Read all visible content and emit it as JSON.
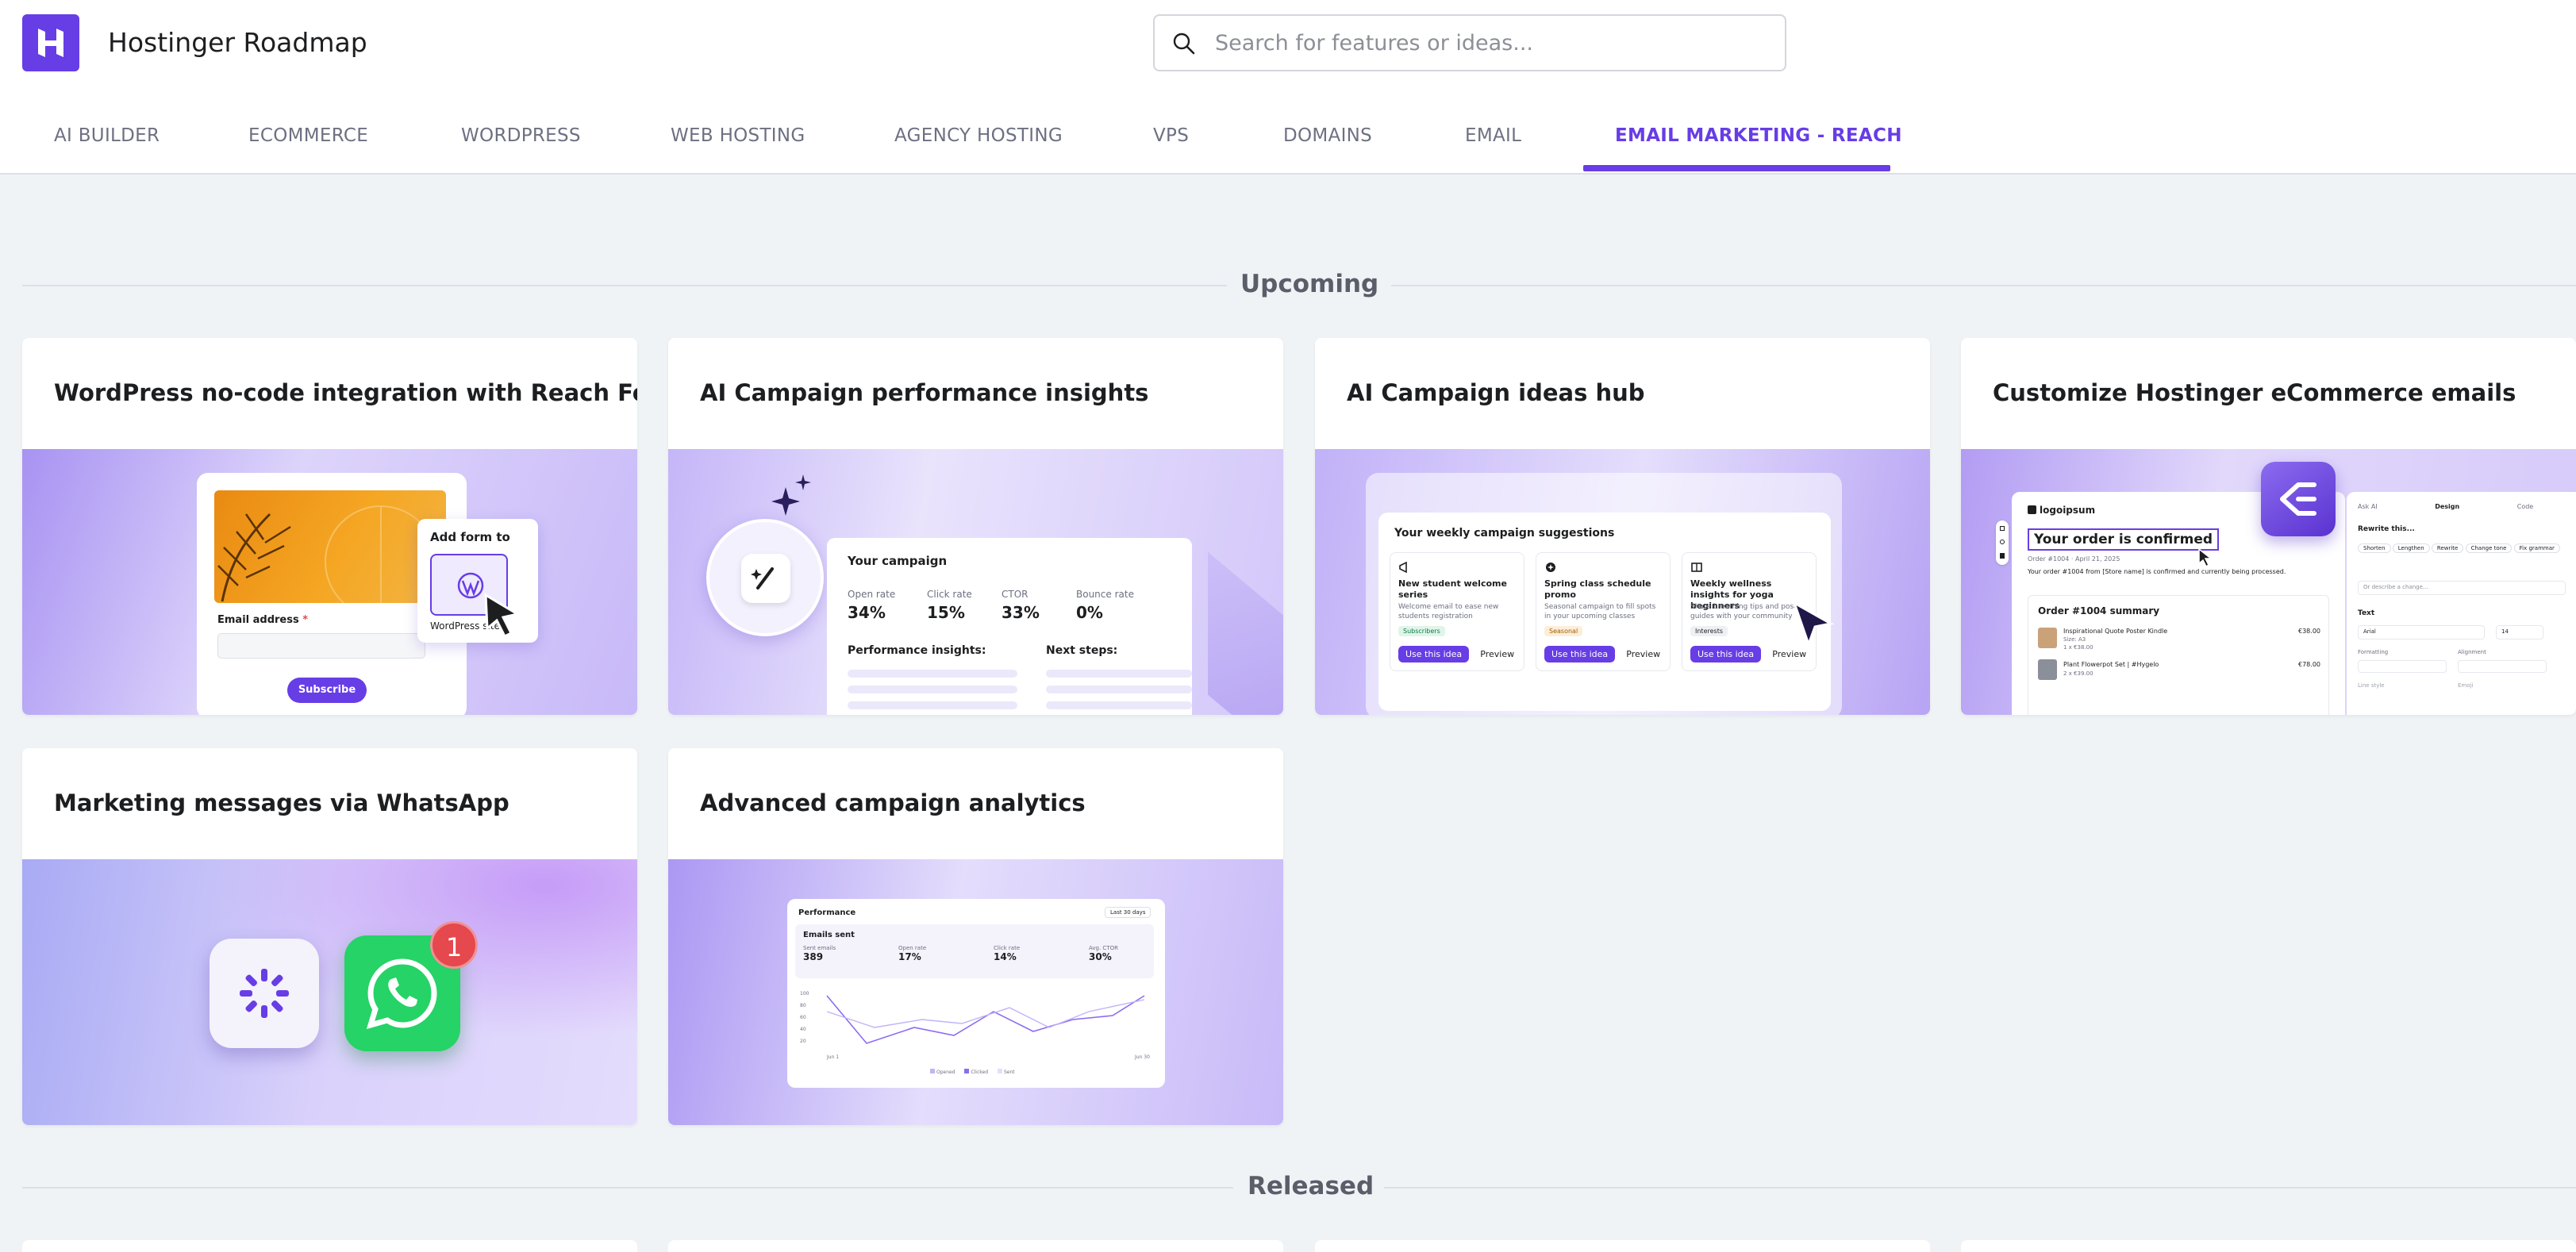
{
  "app": {
    "title": "Hostinger Roadmap",
    "logo_icon": "hostinger-logo-icon",
    "accent": "#673de6"
  },
  "search": {
    "placeholder": "Search for features or ideas...",
    "value": "",
    "icon": "search-icon"
  },
  "tabs": [
    {
      "label": "AI BUILDER",
      "active": false
    },
    {
      "label": "ECOMMERCE",
      "active": false
    },
    {
      "label": "WORDPRESS",
      "active": false
    },
    {
      "label": "WEB HOSTING",
      "active": false
    },
    {
      "label": "AGENCY HOSTING",
      "active": false
    },
    {
      "label": "VPS",
      "active": false
    },
    {
      "label": "DOMAINS",
      "active": false
    },
    {
      "label": "EMAIL",
      "active": false
    },
    {
      "label": "EMAIL MARKETING - REACH",
      "active": true
    }
  ],
  "sections": {
    "upcoming": "Upcoming",
    "released": "Released"
  },
  "cards": [
    {
      "title": "WordPress no-code integration with Reach Forms",
      "image": {
        "add_form_label": "Add form to",
        "wp_label": "WordPress site",
        "email_label": "Email address",
        "required_mark": "*",
        "subscribe": "Subscribe"
      }
    },
    {
      "title": "AI Campaign performance insights",
      "image": {
        "heading": "Your campaign",
        "stats": [
          {
            "label": "Open rate",
            "value": "34%"
          },
          {
            "label": "Click rate",
            "value": "15%"
          },
          {
            "label": "CTOR",
            "value": "33%"
          },
          {
            "label": "Bounce rate",
            "value": "0%"
          }
        ],
        "insights_label": "Performance insights:",
        "next_label": "Next steps:"
      }
    },
    {
      "title": "AI Campaign ideas hub",
      "image": {
        "heading": "Your weekly campaign suggestions",
        "ideas": [
          {
            "title": "New student welcome series",
            "desc": "Welcome email to ease new students registration",
            "tag": "Subscribers",
            "use": "Use this idea",
            "preview": "Preview"
          },
          {
            "title": "Spring class schedule promo",
            "desc": "Seasonal campaign to fill spots in your upcoming classes",
            "tag": "Seasonal",
            "use": "Use this idea",
            "preview": "Preview"
          },
          {
            "title": "Weekly wellness insights for yoga beginners",
            "desc": "Share breathing tips and pose guides with your community",
            "tag": "Interests",
            "use": "Use this idea",
            "preview": "Preview"
          }
        ]
      }
    },
    {
      "title": "Customize Hostinger eCommerce emails",
      "image": {
        "brand": "logoipsum",
        "headline": "Your order is confirmed",
        "order_date": "Order #1004 · April 21, 2025",
        "order_message": "Your order #1004 from [Store name] is confirmed and currently being processed.",
        "summary": "Order #1004 summary",
        "items": [
          {
            "name": "Inspirational Quote Poster Kindle",
            "sub": "Size: A3",
            "qty": "1 x €38.00",
            "price": "€38.00"
          },
          {
            "name": "Plant Flowerpot Set | #Hygelo",
            "sub": "2 x €39.00",
            "qty": "",
            "price": "€78.00"
          }
        ],
        "panel_tabs": [
          "Ask AI",
          "Design",
          "Code"
        ],
        "rewrite_label": "Rewrite this...",
        "rewrite_chips": [
          "Shorten",
          "Lengthen",
          "Rewrite",
          "Change tone",
          "Fix grammar"
        ],
        "describe_placeholder": "Or describe a change...",
        "text_section": "Text",
        "font_value": "Arial",
        "font_size": "14",
        "formatting_label": "Formatting",
        "alignment_label": "Alignment",
        "line_style_label": "Line style",
        "emoji_label": "Emoji"
      }
    },
    {
      "title": "Marketing messages via WhatsApp",
      "image": {
        "badge": "1",
        "whatsapp_color": "#25d366",
        "badge_color": "#e5484d"
      }
    },
    {
      "title": "Advanced campaign analytics",
      "image": {
        "heading": "Performance",
        "range": "Last 30 days",
        "subheading": "Emails sent",
        "stats": [
          {
            "label": "Sent emails",
            "value": "389"
          },
          {
            "label": "Open rate",
            "value": "17%"
          },
          {
            "label": "Click rate",
            "value": "14%"
          },
          {
            "label": "Avg. CTOR",
            "value": "30%"
          }
        ],
        "y_ticks": [
          "100",
          "80",
          "60",
          "40",
          "20"
        ],
        "x_start": "Jun 1",
        "x_end": "Jun 30",
        "legend": [
          "Opened",
          "Clicked",
          "Sent"
        ]
      }
    }
  ]
}
